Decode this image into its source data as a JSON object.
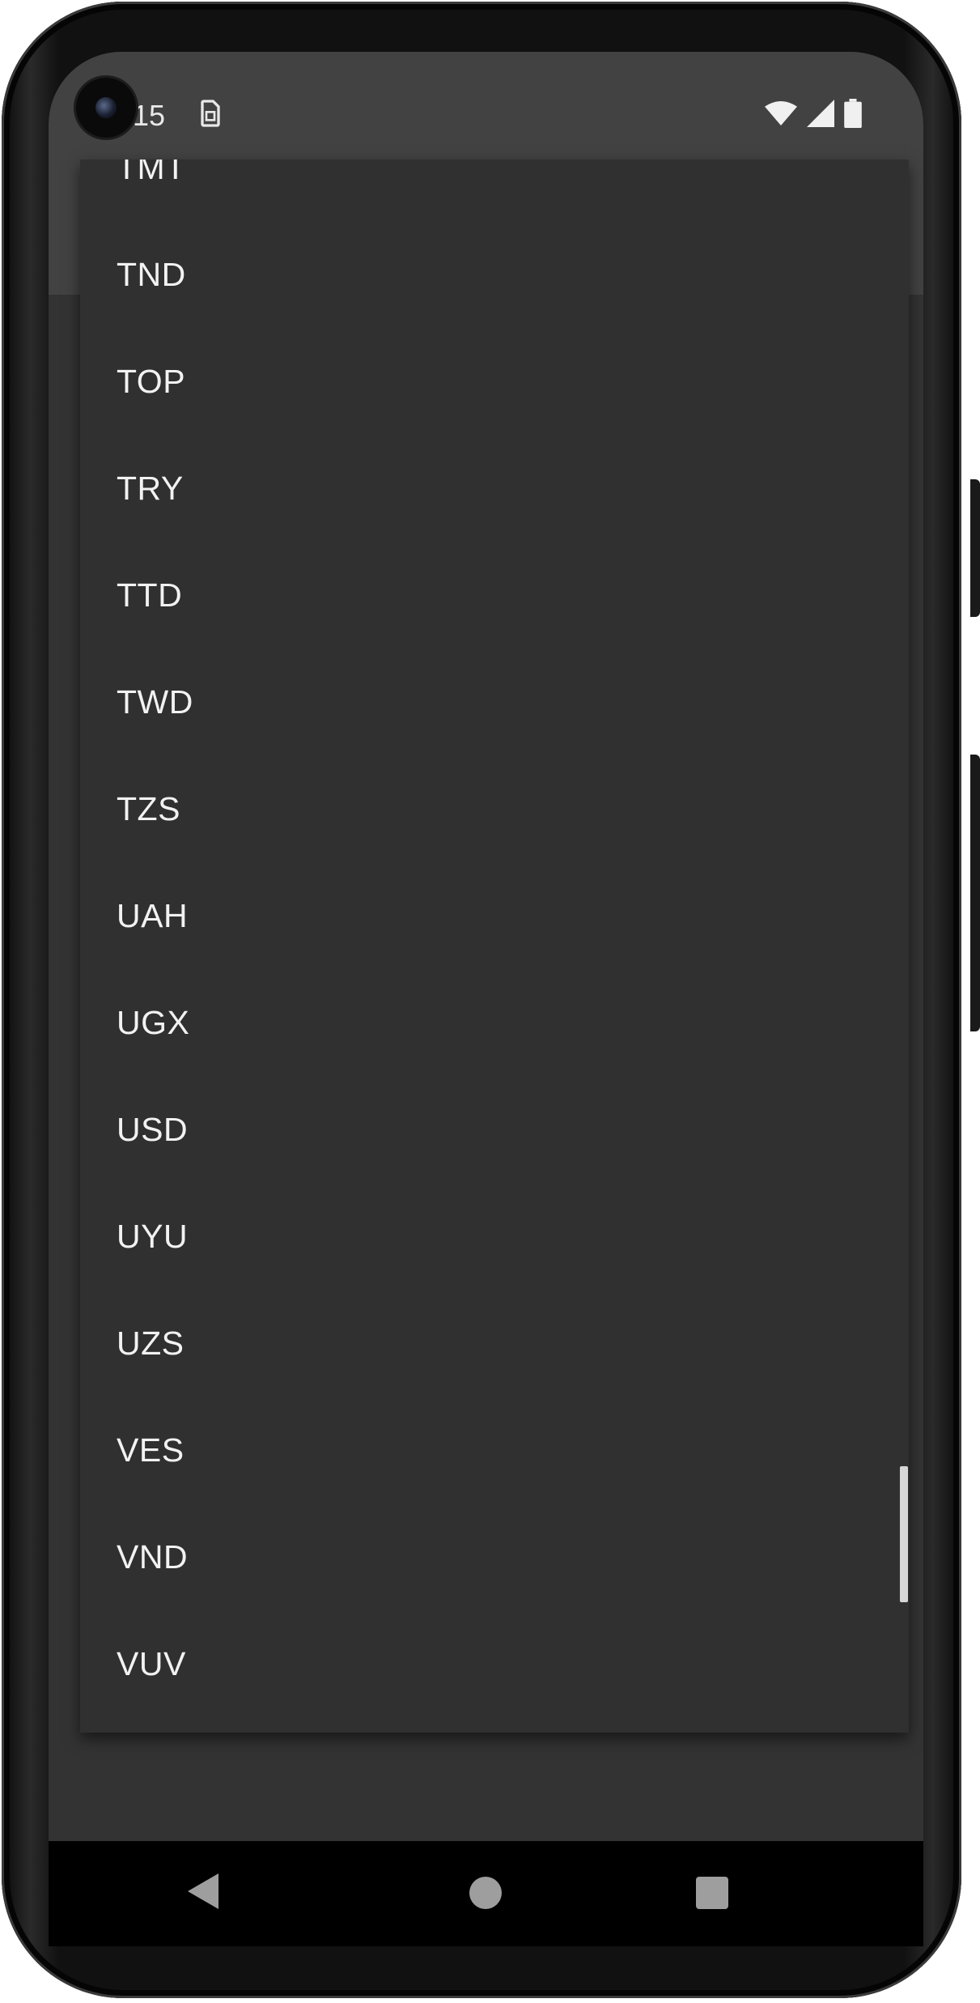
{
  "status_bar": {
    "time": "15",
    "icons": [
      "sim-card-icon",
      "wifi-icon",
      "cellular-signal-icon",
      "battery-icon"
    ]
  },
  "dropdown": {
    "items": [
      "TMT",
      "TND",
      "TOP",
      "TRY",
      "TTD",
      "TWD",
      "TZS",
      "UAH",
      "UGX",
      "USD",
      "UYU",
      "UZS",
      "VES",
      "VND",
      "VUV"
    ]
  },
  "navigation": {
    "icons": [
      "back-icon",
      "home-icon",
      "recents-icon"
    ]
  },
  "colors": {
    "menu_background": "#303030",
    "app_bar": "#424242",
    "text": "#f2f2f2",
    "nav_icons": "#9e9e9e"
  }
}
